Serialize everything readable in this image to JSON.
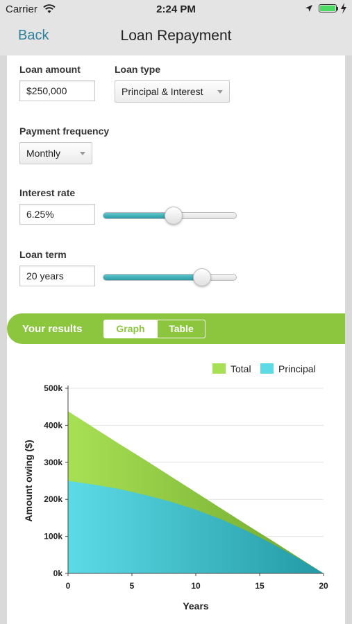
{
  "status": {
    "carrier": "Carrier",
    "time": "2:24 PM"
  },
  "nav": {
    "back_label": "Back",
    "title": "Loan Repayment"
  },
  "form": {
    "loan_amount_label": "Loan amount",
    "loan_amount_value": "$250,000",
    "loan_type_label": "Loan type",
    "loan_type_value": "Principal & Interest",
    "frequency_label": "Payment frequency",
    "frequency_value": "Monthly",
    "interest_label": "Interest rate",
    "interest_value": "6.25%",
    "interest_slider_level": 0.53,
    "term_label": "Loan term",
    "term_value": "20 years",
    "term_slider_level": 0.74
  },
  "results": {
    "label": "Your results",
    "tabs": [
      "Graph",
      "Table"
    ],
    "selected_tab": "Graph"
  },
  "colors": {
    "accent_green": "#8cc63f",
    "teal": "#2a9ba5",
    "link_blue": "#2d7f9b"
  },
  "chart_data": {
    "type": "area",
    "xlabel": "Years",
    "ylabel": "Amount owing ($)",
    "xlim": [
      0,
      20
    ],
    "ylim": [
      0,
      500000
    ],
    "x_ticks": [
      "0",
      "5",
      "10",
      "15",
      "20"
    ],
    "y_ticks": [
      "0k",
      "100k",
      "200k",
      "300k",
      "400k",
      "500k"
    ],
    "grid": true,
    "legend_position": "top-right",
    "x": [
      0,
      2,
      4,
      6,
      8,
      10,
      12,
      14,
      16,
      18,
      20
    ],
    "series": [
      {
        "name": "Total",
        "color": "#8cc63f",
        "values": [
          438000,
          394000,
          350000,
          307000,
          263000,
          219000,
          175000,
          131000,
          88000,
          44000,
          0
        ]
      },
      {
        "name": "Principal",
        "color": "#4dd0dd",
        "values": [
          250000,
          240000,
          228000,
          212000,
          194000,
          172000,
          146000,
          115000,
          80000,
          42000,
          0
        ]
      }
    ]
  }
}
